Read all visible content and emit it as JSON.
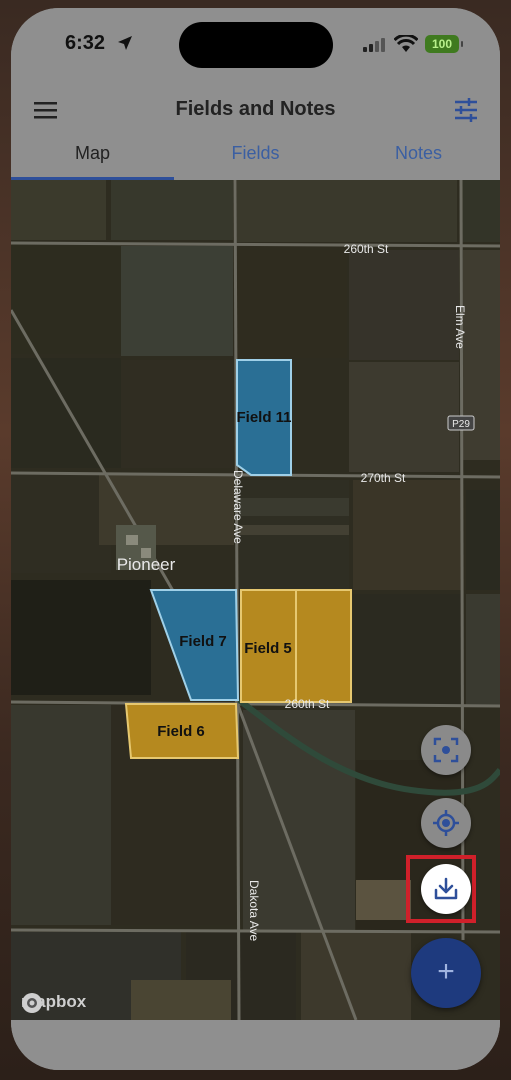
{
  "status_bar": {
    "time": "6:32",
    "battery": "100"
  },
  "header": {
    "title": "Fields and Notes"
  },
  "tabs": [
    {
      "label": "Map",
      "active": true
    },
    {
      "label": "Fields",
      "active": false
    },
    {
      "label": "Notes",
      "active": false
    }
  ],
  "map": {
    "roads": [
      "260th St",
      "270th St",
      "Delaware Ave",
      "Elm Ave",
      "Dakota Ave",
      "P29",
      "260th St"
    ],
    "town": "Pioneer",
    "fields": [
      {
        "name": "Field 11",
        "color": "#2a6f95"
      },
      {
        "name": "Field 7",
        "color": "#2a6f95"
      },
      {
        "name": "Field 5",
        "color": "#b5891f"
      },
      {
        "name": "Field 6",
        "color": "#b5891f"
      }
    ],
    "attribution": "mapbox"
  },
  "buttons": {
    "fit_icon": "fit-bounds-icon",
    "locate_icon": "locate-icon",
    "download_icon": "download-icon",
    "add_label": "+"
  },
  "colors": {
    "accent": "#2e4f9a",
    "highlight": "#d0202a",
    "fab": "#1e3a7e"
  }
}
